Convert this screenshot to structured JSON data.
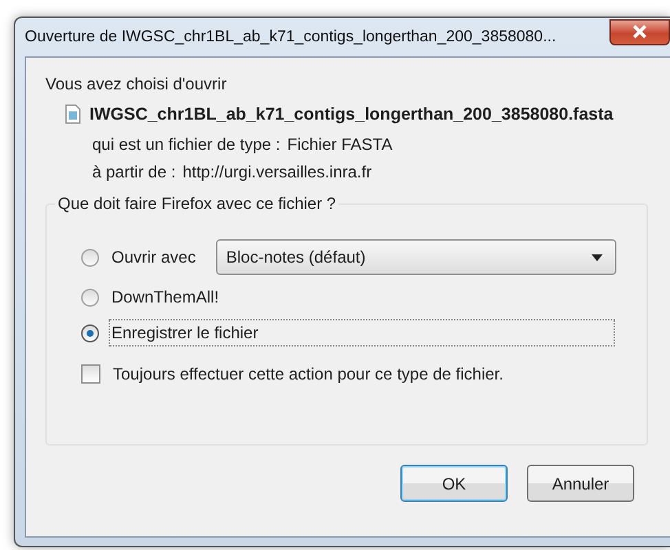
{
  "window": {
    "title": "Ouverture de IWGSC_chr1BL_ab_k71_contigs_longerthan_200_3858080..."
  },
  "intro": "Vous avez choisi d'ouvrir",
  "file": {
    "name": "IWGSC_chr1BL_ab_k71_contigs_longerthan_200_3858080.fasta",
    "type_label": "qui est un fichier de type :",
    "type_value": "Fichier FASTA",
    "source_label": "à partir de :",
    "source_value": "http://urgi.versailles.inra.fr"
  },
  "group": {
    "title": "Que doit faire Firefox avec ce fichier ?",
    "options": [
      {
        "kind": "dropdown",
        "label": "Ouvrir avec",
        "selected": false,
        "value": "Bloc-notes (défaut)"
      },
      {
        "kind": "plain",
        "label": "DownThemAll!",
        "selected": false
      },
      {
        "kind": "plain",
        "label": "Enregistrer le fichier",
        "selected": true
      }
    ],
    "always": {
      "label": "Toujours effectuer cette action pour ce type de fichier.",
      "checked": false
    }
  },
  "buttons": [
    {
      "label": "OK",
      "default": true
    },
    {
      "label": "Annuler",
      "default": false
    }
  ]
}
